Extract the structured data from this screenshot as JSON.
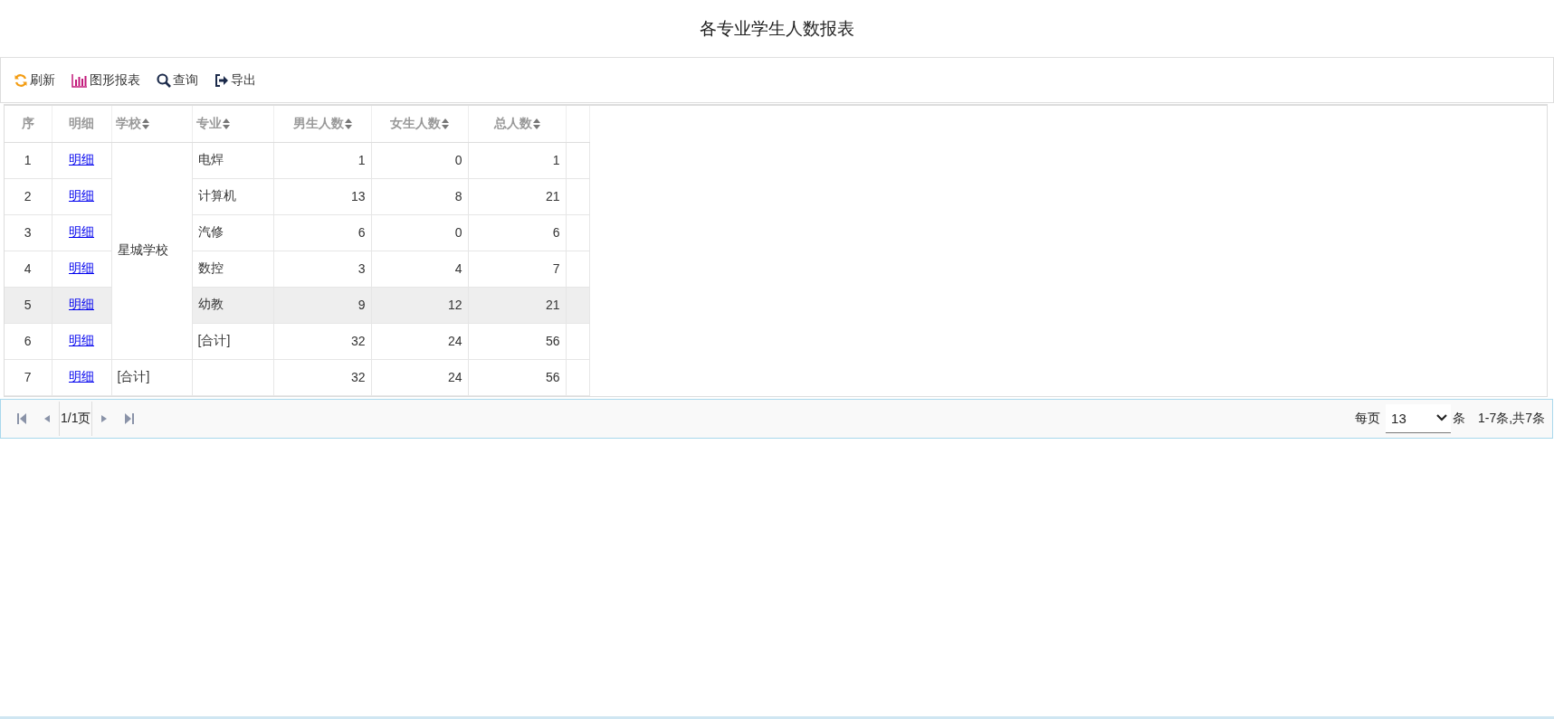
{
  "title": "各专业学生人数报表",
  "toolbar": [
    {
      "kind": "refresh",
      "label": "刷新"
    },
    {
      "kind": "chart",
      "label": "图形报表"
    },
    {
      "kind": "search",
      "label": "查询"
    },
    {
      "kind": "export",
      "label": "导出"
    }
  ],
  "table": {
    "columns": [
      {
        "label": "序",
        "sortable": false
      },
      {
        "label": "明细",
        "sortable": false
      },
      {
        "label": "学校",
        "sortable": true
      },
      {
        "label": "专业",
        "sortable": true
      },
      {
        "label": "男生人数",
        "sortable": true
      },
      {
        "label": "女生人数",
        "sortable": true
      },
      {
        "label": "总人数",
        "sortable": true
      }
    ],
    "groups": [
      {
        "school": "星城学校",
        "rows": [
          {
            "seq": "1",
            "detail": "明细",
            "major": "电焊",
            "male": "1",
            "female": "0",
            "total": "1",
            "selected": false
          },
          {
            "seq": "2",
            "detail": "明细",
            "major": "计算机",
            "male": "13",
            "female": "8",
            "total": "21",
            "selected": false
          },
          {
            "seq": "3",
            "detail": "明细",
            "major": "汽修",
            "male": "6",
            "female": "0",
            "total": "6",
            "selected": false
          },
          {
            "seq": "4",
            "detail": "明细",
            "major": "数控",
            "male": "3",
            "female": "4",
            "total": "7",
            "selected": false
          },
          {
            "seq": "5",
            "detail": "明细",
            "major": "幼教",
            "male": "9",
            "female": "12",
            "total": "21",
            "selected": true
          },
          {
            "seq": "6",
            "detail": "明细",
            "major": "[合计]",
            "male": "32",
            "female": "24",
            "total": "56",
            "selected": false
          }
        ]
      },
      {
        "school": "[合计]",
        "rows": [
          {
            "seq": "7",
            "detail": "明细",
            "male": "32",
            "female": "24",
            "total": "56",
            "selected": false
          }
        ]
      }
    ]
  },
  "pager": {
    "page": "1/1页",
    "per_page_label": "每页",
    "per_page": "13",
    "unit": "条",
    "summary": "1-7条,共7条"
  }
}
